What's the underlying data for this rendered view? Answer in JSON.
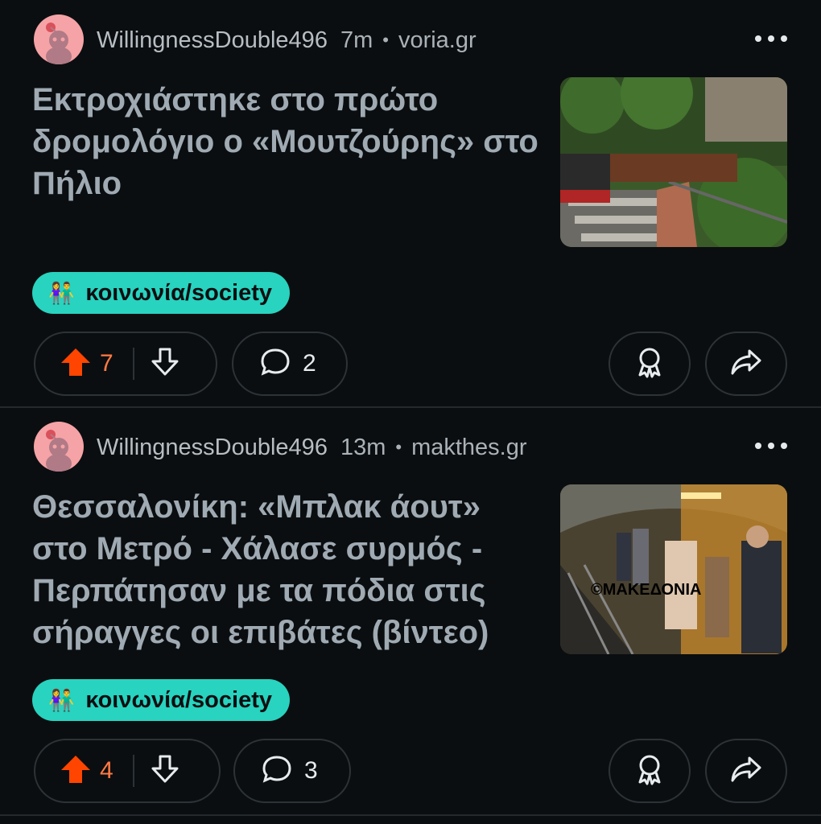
{
  "posts": [
    {
      "author": "WillingnessDouble496",
      "time": "7m",
      "domain": "voria.gr",
      "title": "Εκτροχιάστηκε στο πρώτο δρομολόγιο ο «Μουτζούρης» στο Πήλιο",
      "flair_emoji": "👫",
      "flair": "κοινωνία/society",
      "upvotes": "7",
      "comments": "2",
      "thumbnail_icon": "train-photo"
    },
    {
      "author": "WillingnessDouble496",
      "time": "13m",
      "domain": "makthes.gr",
      "title": "Θεσσαλονίκη: «Μπλακ άουτ» στο Μετρό - Χάλασε συρμός - Περπάτησαν με τα πόδια στις σήραγγες οι επιβάτες (βίντεο)",
      "flair_emoji": "👫",
      "flair": "κοινωνία/society",
      "upvotes": "4",
      "comments": "3",
      "thumbnail_icon": "metro-tunnel-photo",
      "thumbnail_watermark": "©ΜΑΚΕΔΟΝΙΑ"
    }
  ],
  "colors": {
    "accent_upvote": "#ff4500",
    "flair_bg": "#28d3bf",
    "background": "#0b0e10"
  }
}
